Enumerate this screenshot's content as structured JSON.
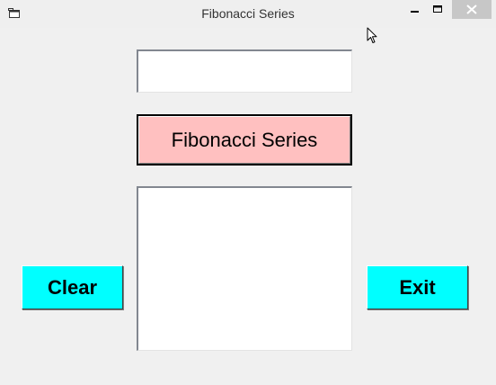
{
  "window": {
    "title": "Fibonacci Series",
    "icon": "window-app-icon",
    "controls": {
      "minimize": "minimize-icon",
      "maximize": "maximize-icon",
      "close": "close-icon"
    }
  },
  "form": {
    "input": {
      "value": "",
      "placeholder": ""
    },
    "fibonacci_button_label": "Fibonacci Series",
    "clear_button_label": "Clear",
    "exit_button_label": "Exit",
    "output_list": []
  },
  "colors": {
    "fibonacci_button": "#ffc0c0",
    "clear_button": "#00ffff",
    "exit_button": "#00ffff",
    "close_button_bg": "#c7c7c7"
  }
}
